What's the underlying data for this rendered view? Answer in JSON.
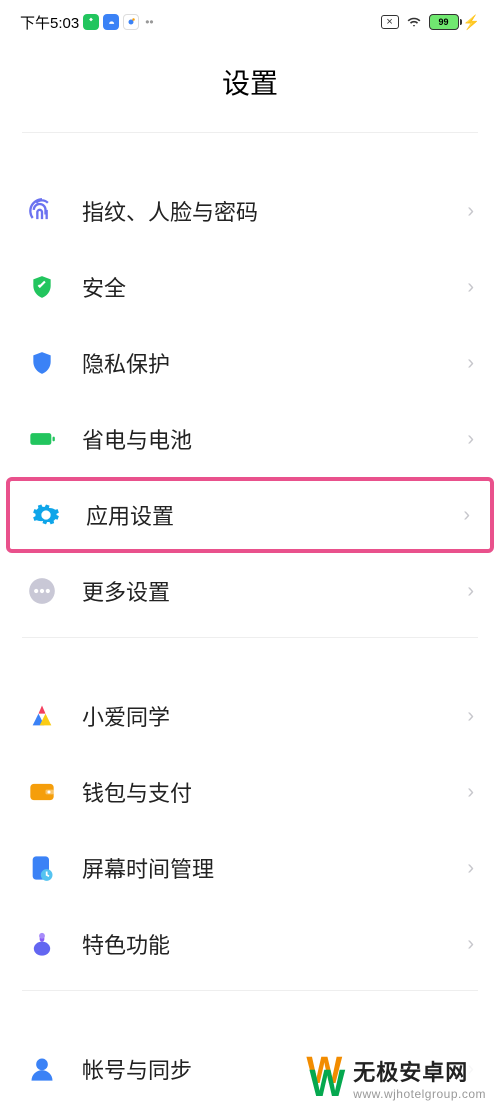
{
  "status": {
    "time": "下午5:03",
    "battery": "99"
  },
  "title": "设置",
  "groups": [
    {
      "items": [
        {
          "key": "fingerprint",
          "label": "指纹、人脸与密码"
        },
        {
          "key": "security",
          "label": "安全"
        },
        {
          "key": "privacy",
          "label": "隐私保护"
        },
        {
          "key": "battery",
          "label": "省电与电池"
        },
        {
          "key": "apps",
          "label": "应用设置",
          "highlight": true
        },
        {
          "key": "more",
          "label": "更多设置"
        }
      ]
    },
    {
      "items": [
        {
          "key": "ai",
          "label": "小爱同学"
        },
        {
          "key": "wallet",
          "label": "钱包与支付"
        },
        {
          "key": "screentime",
          "label": "屏幕时间管理"
        },
        {
          "key": "features",
          "label": "特色功能"
        }
      ]
    },
    {
      "items": [
        {
          "key": "account",
          "label": "帐号与同步"
        }
      ]
    }
  ],
  "watermark": {
    "name": "无极安卓网",
    "url": "www.wjhotelgroup.com"
  }
}
